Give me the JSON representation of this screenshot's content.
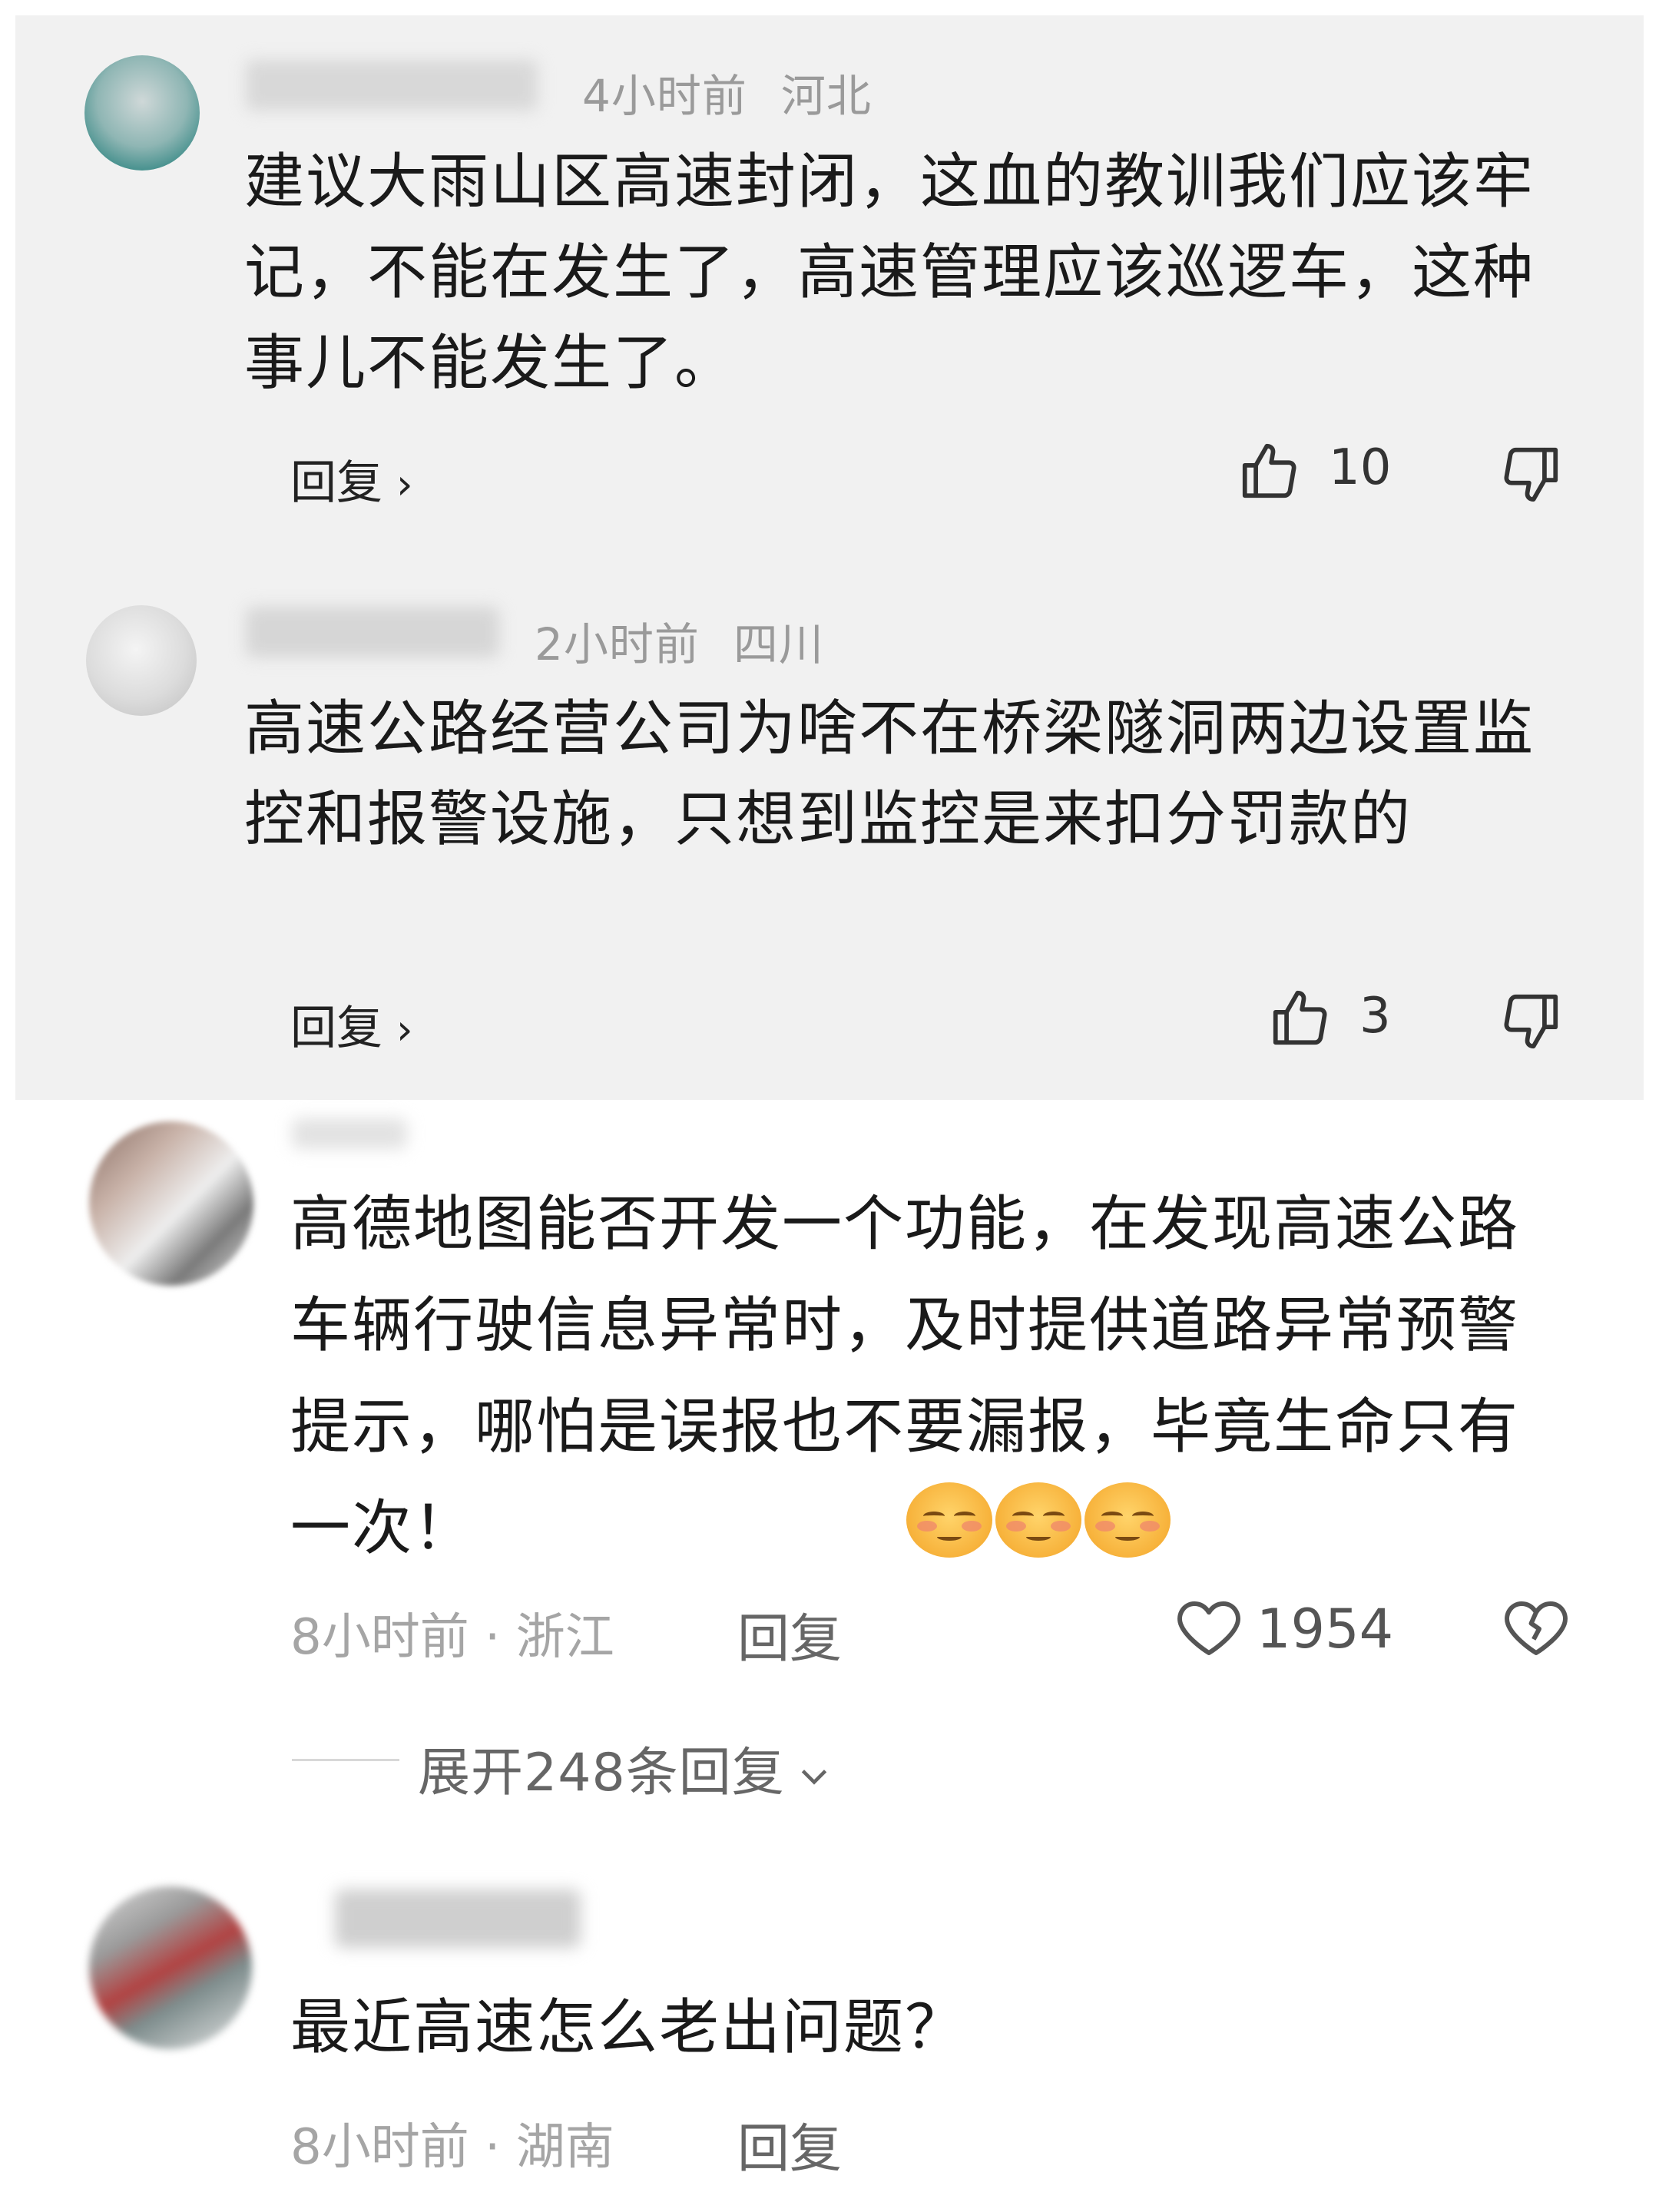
{
  "comments": [
    {
      "time": "4小时前",
      "location": "河北",
      "text": "建议大雨山区高速封闭，这血的教训我们应该牢记，不能在发生了，高速管理应该巡逻车，这种事儿不能发生了。",
      "reply_label": "回复",
      "like_count": "10"
    },
    {
      "time": "2小时前",
      "location": "四川",
      "text": "高速公路经营公司为啥不在桥梁隧洞两边设置监控和报警设施，只想到监控是来扣分罚款的",
      "reply_label": "回复",
      "like_count": "3"
    },
    {
      "text": "高德地图能否开发一个功能，在发现高速公路车辆行驶信息异常时，及时提供道路异常预警提示，哪怕是误报也不要漏报，毕竟生命只有一次！",
      "meta": "8小时前 · 浙江",
      "reply_label": "回复",
      "like_count": "1954",
      "expand_label": "展开248条回复"
    },
    {
      "text": "最近高速怎么老出问题？",
      "meta": "8小时前 · 湖南",
      "reply_label": "回复"
    }
  ],
  "icons": {
    "thumb_up": "thumb-up-icon",
    "thumb_down": "thumb-down-icon",
    "heart": "heart-icon",
    "broken_heart": "broken-heart-icon",
    "chevron_right": "chevron-right-icon",
    "chevron_down": "chevron-down-icon",
    "emoji": "smirk-emoji-icon"
  },
  "colors": {
    "top_panel_bg": "#f1f1f1",
    "meta_text": "#9a9a9a",
    "body_text": "#1a1a1a"
  }
}
